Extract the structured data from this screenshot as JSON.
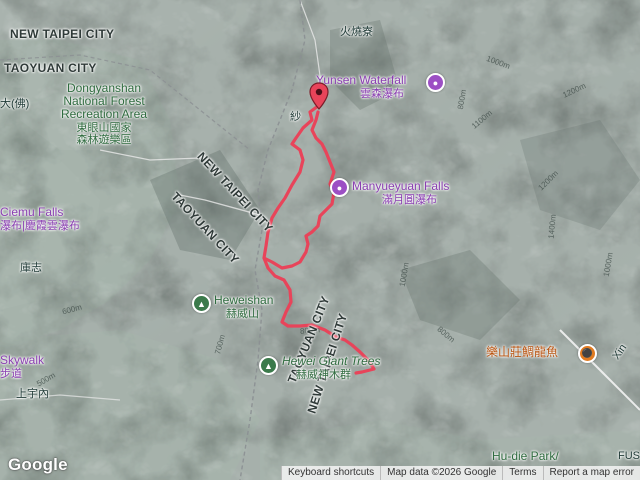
{
  "map": {
    "city_labels": [
      "NEW TAIPEI CITY",
      "TAOYUAN CITY",
      "NEW TAIPEI CITY",
      "TAOYUAN CITY",
      "TAOYUAN CITY",
      "NEW TAIPEI CITY"
    ],
    "places": {
      "huoshaoliao": "火燒寮",
      "yunsen_en": "Yunsen Waterfall",
      "yunsen_zh": "雲森瀑布",
      "manyueyuan_en": "Manyueyuan Falls",
      "manyueyuan_zh": "滿月圓瀑布",
      "dongyanshan_en": "Dongyanshan National Forest Recreation Area",
      "dongyanshan_zh": "東眼山國家森林遊樂區",
      "xiaowushan": "大(佛)",
      "cimu_en": "Ciemu Falls",
      "cimu_zh": "瀑布|慶霞雲瀑布",
      "kangzhi": "庫志",
      "heweishan_en": "Heweishan",
      "heweishan_zh": "赫威山",
      "hewei_trees_en": "Hewei Giant Trees",
      "hewei_trees_zh": "赫威神木群",
      "leshan_zh": "樂山莊鯛龍魚",
      "shangyunei": "上宇內",
      "skywalk_en": "Skywalk",
      "skywalk_zh": "步道",
      "hudie_en": "Hu-die Park/",
      "xin": "Xin",
      "fu": "FUS",
      "start": "紗"
    },
    "contours": [
      "1000m",
      "1200m",
      "800m",
      "800m",
      "1100m",
      "1200m",
      "1000m",
      "600m",
      "500m",
      "700m",
      "800m",
      "1400m",
      "800m",
      "1000m"
    ],
    "footer": {
      "keyboard": "Keyboard shortcuts",
      "mapdata": "Map data ©2026 Google",
      "terms": "Terms",
      "report": "Report a map error"
    },
    "logo": "Google",
    "colors": {
      "track": "#e8445a",
      "poi_purple": "#9c4fc4",
      "poi_green": "#3b7a4b",
      "poi_orange": "#e07b21"
    }
  }
}
